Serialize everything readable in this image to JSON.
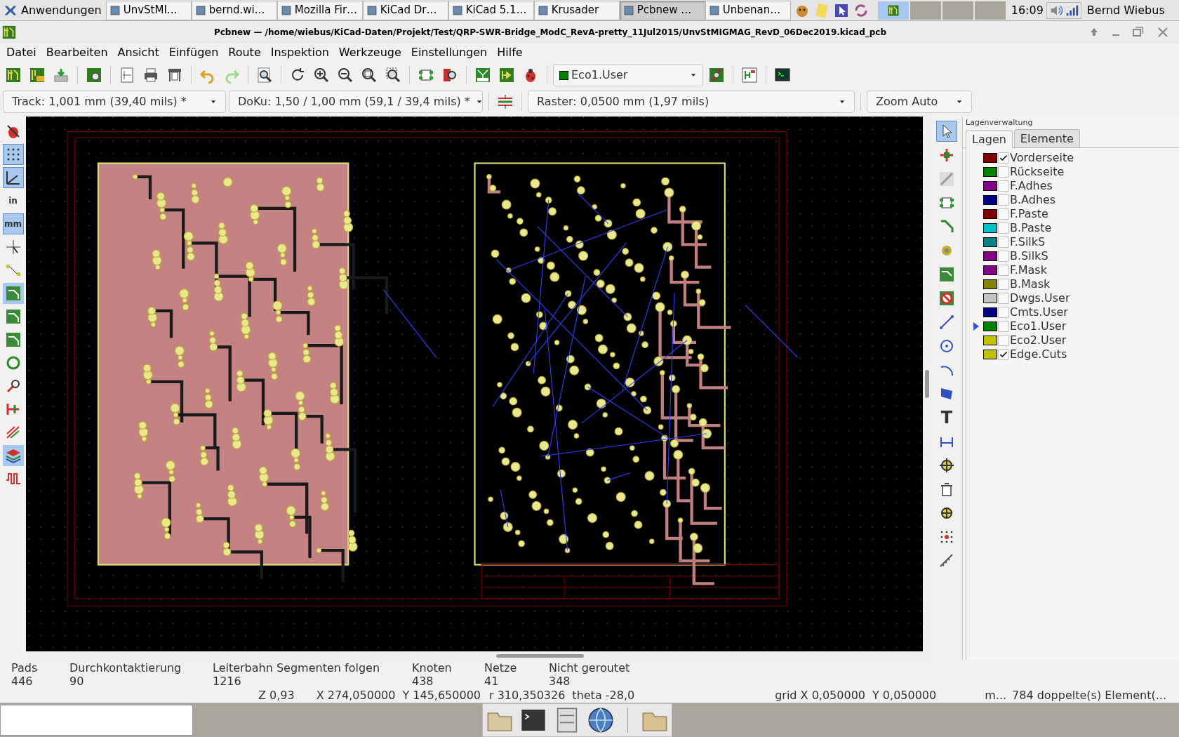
{
  "taskbar": {
    "start": "Anwendungen",
    "tasks": [
      {
        "label": "UnvStMI…",
        "selected": false
      },
      {
        "label": "bernd.wi…",
        "selected": false
      },
      {
        "label": "Mozilla Fir…",
        "selected": false
      },
      {
        "label": "KiCad Dr…",
        "selected": false
      },
      {
        "label": "KiCad 5.1…",
        "selected": false
      },
      {
        "label": "Krusader",
        "selected": false
      },
      {
        "label": "Pcbnew …",
        "selected": true
      },
      {
        "label": "Unbenan…",
        "selected": false
      }
    ],
    "clock": "16:09",
    "user": "Bernd Wiebus"
  },
  "window": {
    "title": "Pcbnew — /home/wiebus/KiCad-Daten/Projekt/Test/QRP-SWR-Bridge_ModC_RevA-pretty_11Jul2015/UnvStMIGMAG_RevD_06Dec2019.kicad_pcb"
  },
  "menu": [
    "Datei",
    "Bearbeiten",
    "Ansicht",
    "Einfügen",
    "Route",
    "Inspektion",
    "Werkzeuge",
    "Einstellungen",
    "Hilfe"
  ],
  "toolbar": {
    "layer_select": "Eco1.User"
  },
  "options_bar": {
    "track": "Track: 1,001 mm (39,40 mils) *",
    "via": "DoKu: 1,50 / 1,00 mm (59,1 / 39,4 mils) *",
    "grid": "Raster: 0,0500 mm (1,97 mils)",
    "zoom": "Zoom Auto"
  },
  "left_toolbar": {
    "units": [
      {
        "label": "in",
        "selected": false
      },
      {
        "label": "mm",
        "selected": true
      }
    ]
  },
  "right_toolbar": {
    "text_tool": "T"
  },
  "layer_manager": {
    "title": "Lagenverwaltung",
    "tabs": [
      {
        "label": "Lagen",
        "selected": true
      },
      {
        "label": "Elemente",
        "selected": false
      }
    ],
    "layers": [
      {
        "name": "Vorderseite",
        "color": "#840000",
        "checked": true,
        "current": false
      },
      {
        "name": "Rückseite",
        "color": "#008400",
        "checked": false,
        "current": false
      },
      {
        "name": "F.Adhes",
        "color": "#840084",
        "checked": false,
        "current": false
      },
      {
        "name": "B.Adhes",
        "color": "#000084",
        "checked": false,
        "current": false
      },
      {
        "name": "F.Paste",
        "color": "#840000",
        "checked": false,
        "current": false
      },
      {
        "name": "B.Paste",
        "color": "#00c2c2",
        "checked": false,
        "current": false
      },
      {
        "name": "F.SilkS",
        "color": "#008484",
        "checked": false,
        "current": false
      },
      {
        "name": "B.SilkS",
        "color": "#840084",
        "checked": false,
        "current": false
      },
      {
        "name": "F.Mask",
        "color": "#840084",
        "checked": false,
        "current": false
      },
      {
        "name": "B.Mask",
        "color": "#848400",
        "checked": false,
        "current": false
      },
      {
        "name": "Dwgs.User",
        "color": "#c2c2c2",
        "checked": false,
        "current": false
      },
      {
        "name": "Cmts.User",
        "color": "#000084",
        "checked": false,
        "current": false
      },
      {
        "name": "Eco1.User",
        "color": "#008400",
        "checked": false,
        "current": true
      },
      {
        "name": "Eco2.User",
        "color": "#c2c200",
        "checked": false,
        "current": false
      },
      {
        "name": "Edge.Cuts",
        "color": "#c2c200",
        "checked": true,
        "current": false
      }
    ]
  },
  "stats": [
    {
      "label": "Pads",
      "value": "446"
    },
    {
      "label": "Durchkontaktierung",
      "value": "90"
    },
    {
      "label": "Leiterbahn Segmenten folgen",
      "value": "1216"
    },
    {
      "label": "Knoten",
      "value": "438"
    },
    {
      "label": "Netze",
      "value": "41"
    },
    {
      "label": "Nicht geroutet",
      "value": "348"
    }
  ],
  "status_bar": [
    "Z 0,93",
    "X 274,050000",
    "Y 145,650000",
    "r 310,350326",
    "theta -28,0",
    "grid X 0,050000",
    "Y 0,050000",
    "m...",
    "784 doppelte(s) Element(..."
  ]
}
